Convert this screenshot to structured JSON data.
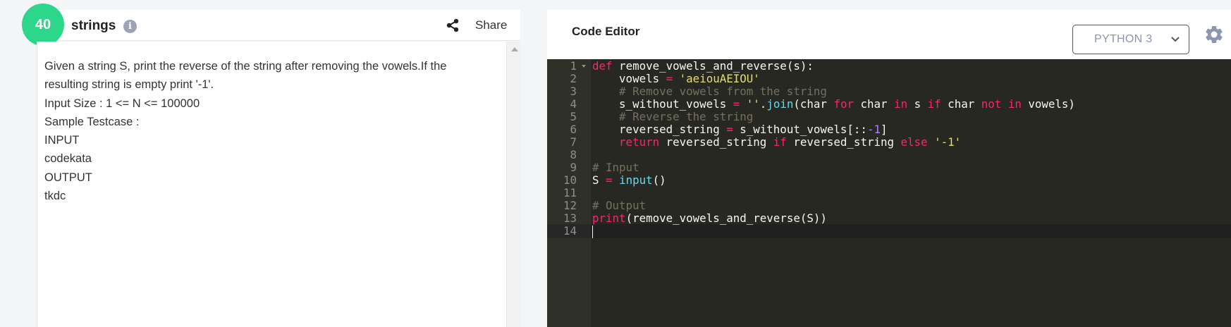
{
  "problem": {
    "number": "40",
    "title": "strings",
    "info_icon": "i",
    "share_label": "Share",
    "description": [
      "Given a string S, print the reverse of the string after removing the vowels.If the",
      "resulting string is empty print '-1'.",
      "Input Size : 1 <= N <= 100000",
      "Sample Testcase :",
      "INPUT",
      "codekata",
      "OUTPUT",
      "tkdc"
    ]
  },
  "editor": {
    "title": "Code Editor",
    "language": "PYTHON 3",
    "settings_icon": "gear-icon",
    "line_numbers": [
      "1",
      "2",
      "3",
      "4",
      "5",
      "6",
      "7",
      "8",
      "9",
      "10",
      "11",
      "12",
      "13",
      "14"
    ],
    "code": {
      "l1": {
        "kw": "def",
        "rest": " remove_vowels_and_reverse(s):"
      },
      "l2": {
        "a": "    vowels ",
        "op": "=",
        "sp": " ",
        "str": "'aeiouAEIOU'"
      },
      "l3": {
        "cm": "    # Remove vowels from the string"
      },
      "l4": {
        "a": "    s_without_vowels ",
        "op": "=",
        "sp": " ",
        "str": "''",
        "dot": ".",
        "fn": "join",
        "b": "(char ",
        "kw1": "for",
        "c": " char ",
        "kw2": "in",
        "d": " s ",
        "kw3": "if",
        "e": " char ",
        "kw4": "not",
        "f": " ",
        "kw5": "in",
        "g": " vowels)"
      },
      "l5": {
        "cm": "    # Reverse the string"
      },
      "l6": {
        "a": "    reversed_string ",
        "op": "=",
        "b": " s_without_vowels[::",
        "num": "-1",
        "c": "]"
      },
      "l7": {
        "kw1": "    return",
        "a": " reversed_string ",
        "kw2": "if",
        "b": " reversed_string ",
        "kw3": "else",
        "sp": " ",
        "str": "'-1'"
      },
      "l9": {
        "cm": "# Input"
      },
      "l10": {
        "a": "S ",
        "op": "=",
        "sp": " ",
        "fn": "input",
        "b": "()"
      },
      "l12": {
        "cm": "# Output"
      },
      "l13": {
        "fn": "print",
        "b": "(remove_vowels_and_reverse(S))"
      }
    }
  },
  "colors": {
    "badge": "#2cd68b",
    "editor_bg": "#272822",
    "keyword": "#f92672",
    "builtin": "#66d9ef",
    "string": "#e6db74",
    "comment": "#75715e",
    "number": "#ae81ff"
  }
}
